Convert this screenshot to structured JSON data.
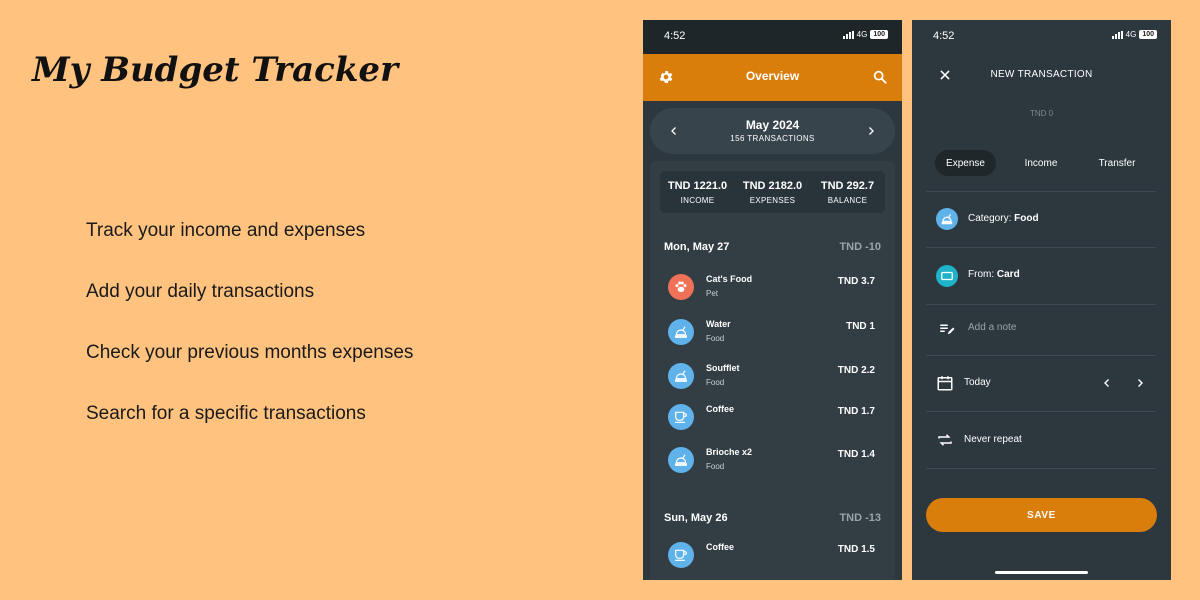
{
  "hero": {
    "title": "My Budget Tracker",
    "features": [
      "Track your income and expenses",
      "Add your daily transactions",
      "Check your previous months expenses",
      "Search for a specific transactions"
    ]
  },
  "colors": {
    "background": "#ffc27f",
    "accent": "#d97e0a",
    "phone_bg": "#2d373e"
  },
  "phone1": {
    "status": {
      "time": "4:52",
      "network": "4G",
      "battery": "100"
    },
    "header": {
      "title": "Overview"
    },
    "month": {
      "name": "May 2024",
      "count": "156 TRANSACTIONS"
    },
    "summary": [
      {
        "value": "TND 1221.0",
        "label": "INCOME"
      },
      {
        "value": "TND 2182.0",
        "label": "EXPENSES"
      },
      {
        "value": "TND 292.7",
        "label": "BALANCE"
      }
    ],
    "days": [
      {
        "date": "Mon, May 27",
        "total": "TND -10",
        "items": [
          {
            "name": "Cat's Food",
            "category": "Pet",
            "amount": "TND 3.7",
            "icon": "paw-icon"
          },
          {
            "name": "Water",
            "category": "Food",
            "amount": "TND 1",
            "icon": "food-icon"
          },
          {
            "name": "Soufflet",
            "category": "Food",
            "amount": "TND 2.2",
            "icon": "food-icon"
          },
          {
            "name": "Coffee",
            "category": "",
            "amount": "TND 1.7",
            "icon": "coffee-icon"
          },
          {
            "name": "Brioche x2",
            "category": "Food",
            "amount": "TND 1.4",
            "icon": "food-icon"
          }
        ]
      },
      {
        "date": "Sun, May 26",
        "total": "TND -13",
        "items": [
          {
            "name": "Coffee",
            "category": "",
            "amount": "TND 1.5",
            "icon": "coffee-icon"
          }
        ]
      }
    ]
  },
  "phone2": {
    "status": {
      "time": "4:52",
      "network": "4G",
      "battery": "100"
    },
    "title": "NEW TRANSACTION",
    "amount": "TND 0",
    "tabs": [
      {
        "label": "Expense",
        "active": true
      },
      {
        "label": "Income",
        "active": false
      },
      {
        "label": "Transfer",
        "active": false
      }
    ],
    "category": {
      "label": "Category:",
      "value": "Food"
    },
    "from": {
      "label": "From:",
      "value": "Card"
    },
    "note_placeholder": "Add a note",
    "date": "Today",
    "repeat": "Never repeat",
    "save": "SAVE"
  }
}
